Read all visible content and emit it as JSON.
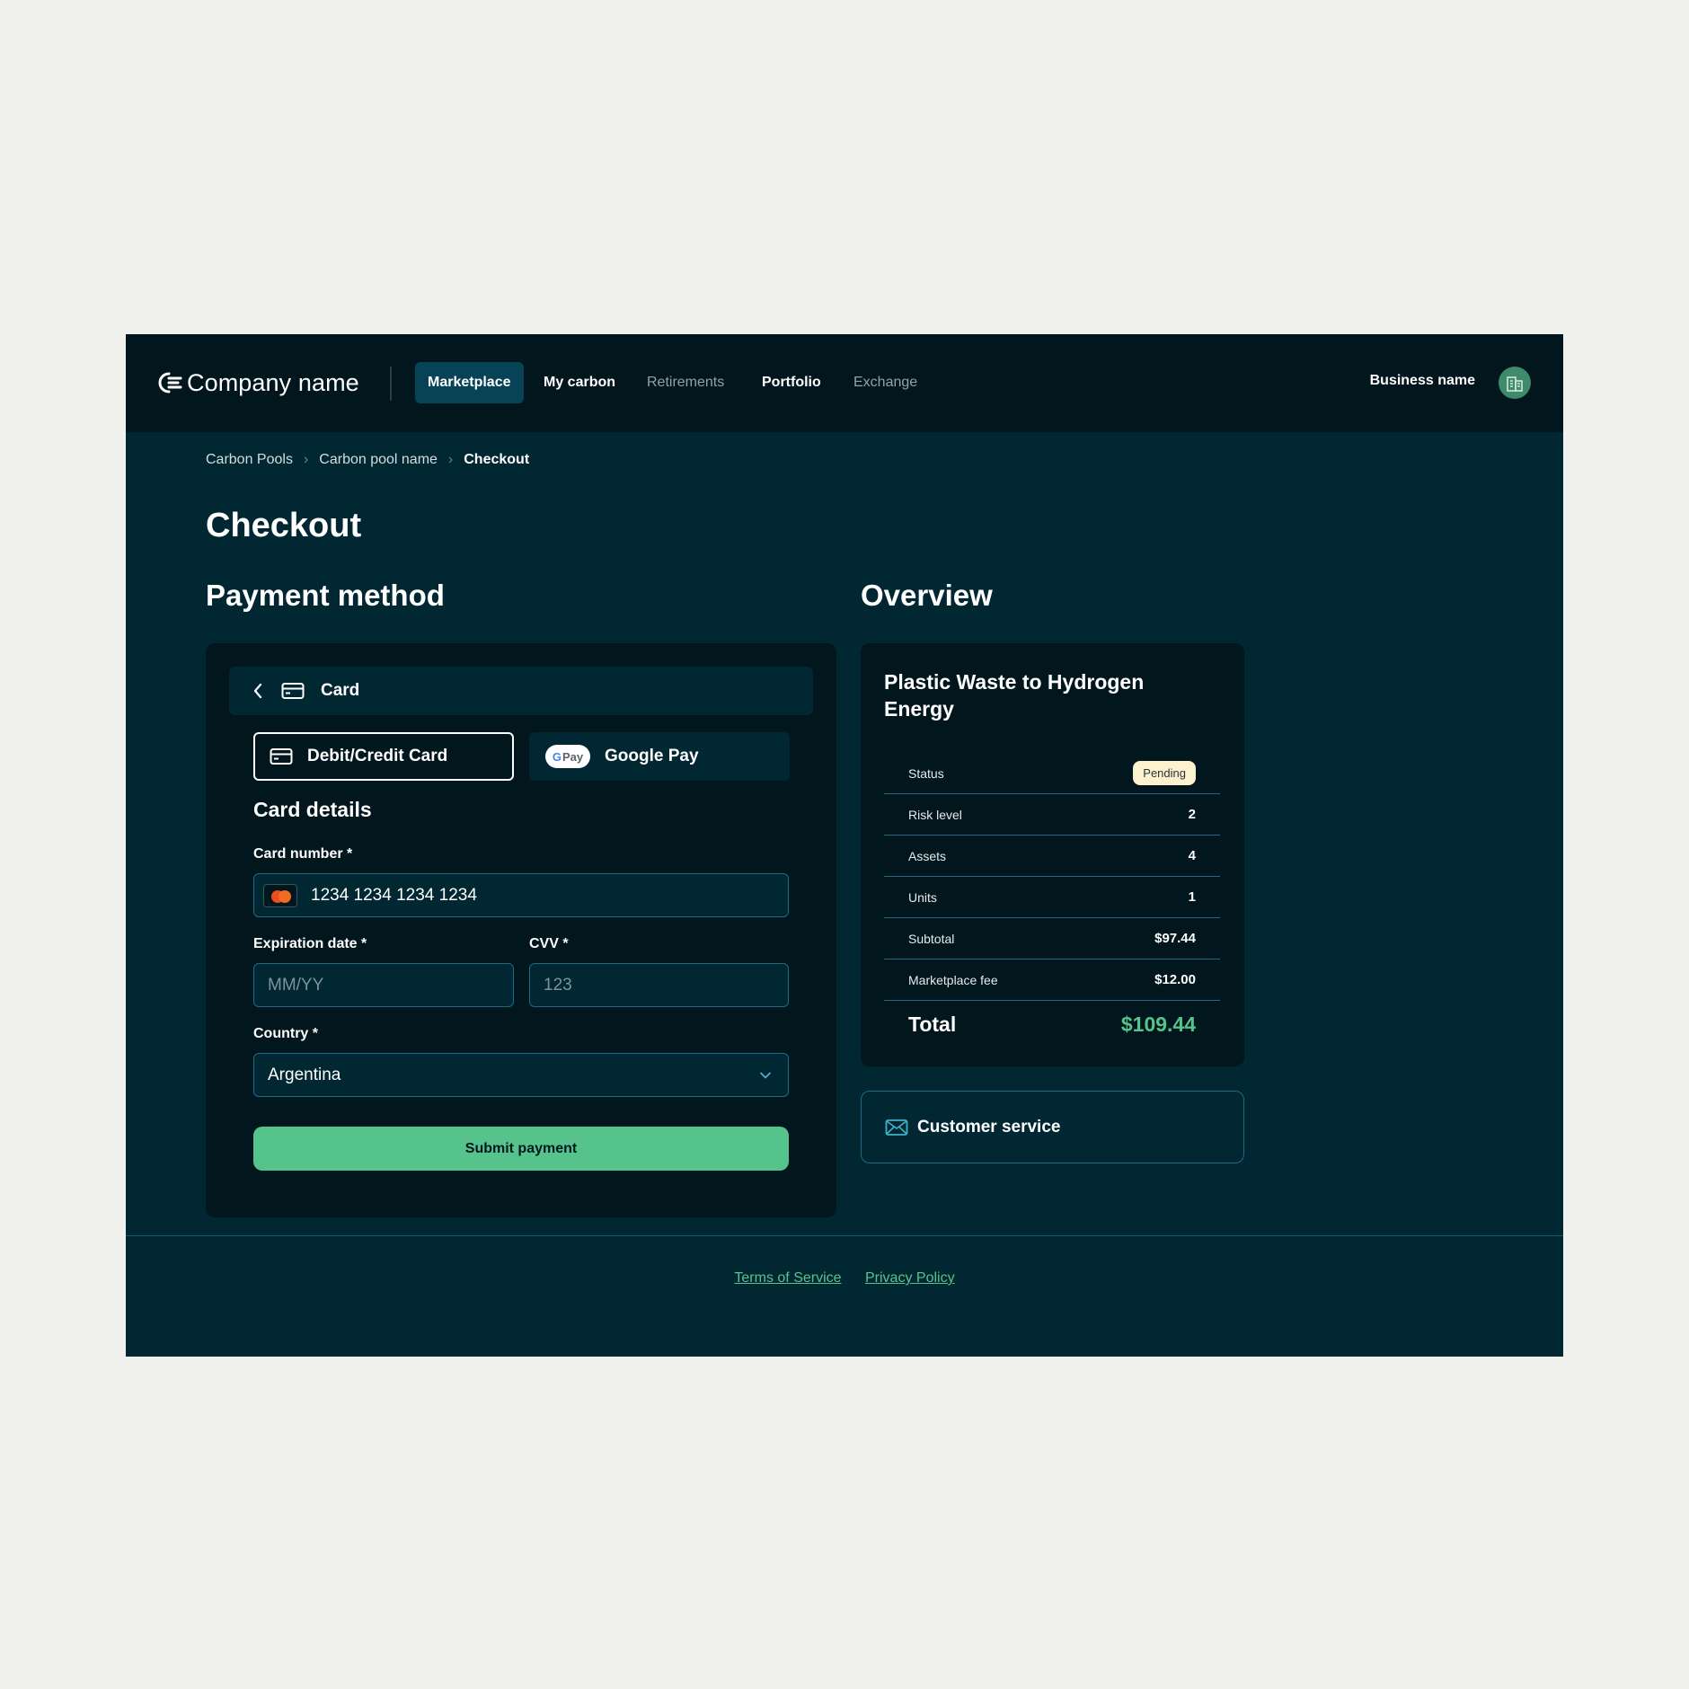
{
  "nav": {
    "company_name": "Company name",
    "items": [
      {
        "label": "Marketplace"
      },
      {
        "label": "My carbon"
      },
      {
        "label": "Retirements"
      },
      {
        "label": "Portfolio"
      },
      {
        "label": "Exchange"
      }
    ],
    "active_item": "Marketplace",
    "business_name": "Business name"
  },
  "breadcrumb": [
    "Carbon Pools",
    "Carbon pool name",
    "Checkout"
  ],
  "page_title": "Checkout",
  "payment": {
    "section_title": "Payment method",
    "header_label": "Card",
    "methods": [
      {
        "label": "Debit/Credit Card",
        "selected": true
      },
      {
        "label": "Google Pay",
        "selected": false
      }
    ],
    "gpay_badge": "Pay",
    "card_details_title": "Card details",
    "card_number_label": "Card number  *",
    "card_number_value": "1234 1234 1234 1234",
    "expiration_label": "Expiration date  *",
    "expiration_placeholder": "MM/YY",
    "cvv_label": "CVV  *",
    "cvv_placeholder": "123",
    "country_label": "Country  *",
    "country_value": "Argentina",
    "submit_label": "Submit payment"
  },
  "overview": {
    "section_title": "Overview",
    "project_title": "Plastic Waste to Hydrogen Energy",
    "rows": [
      {
        "key": "Status",
        "value": "Pending"
      },
      {
        "key": "Risk level",
        "value": "2"
      },
      {
        "key": "Assets",
        "value": "4"
      },
      {
        "key": "Units",
        "value": "1"
      },
      {
        "key": "Subtotal",
        "value": "$97.44"
      },
      {
        "key": "Marketplace fee",
        "value": "$12.00"
      }
    ],
    "total_label": "Total",
    "total_value": "$109.44",
    "customer_service_label": "Customer service"
  },
  "footer": {
    "links": [
      "Terms of Service",
      "Privacy Policy"
    ]
  },
  "colors": {
    "background_outer": "#f0f0ec",
    "nav_bg": "#01161d",
    "page_bg": "#012733",
    "accent_green": "#57c38c",
    "border_blue": "#1d6a86",
    "pending_badge": "#fdf2cd"
  }
}
